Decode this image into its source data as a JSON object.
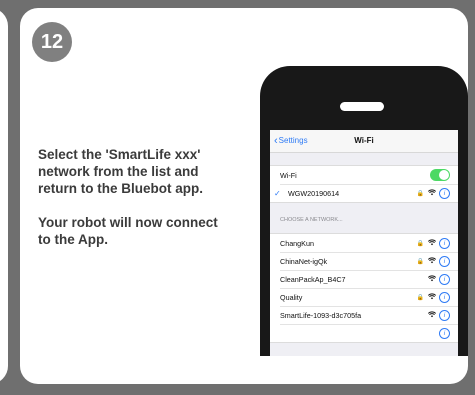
{
  "step_number": "12",
  "instructions": {
    "line1": "Select the 'SmartLife xxx' network from the list and return to the Bluebot app.",
    "line2": "Your robot will now connect to the App."
  },
  "phone": {
    "nav": {
      "back_label": "Settings",
      "title": "Wi-Fi"
    },
    "wifi_toggle": {
      "label": "Wi-Fi",
      "on": true
    },
    "connected_network": "WGW20190614",
    "section_header": "CHOOSE A NETWORK...",
    "networks": [
      {
        "name": "ChangKun",
        "locked": true
      },
      {
        "name": "ChinaNet-igQk",
        "locked": true
      },
      {
        "name": "CleanPackAp_B4C7",
        "locked": false
      },
      {
        "name": "Quality",
        "locked": true
      },
      {
        "name": "SmartLife-1093-d3c705fa",
        "locked": false
      }
    ]
  },
  "colors": {
    "accent": "#2f7bf5",
    "toggle_on": "#4cd964",
    "badge": "#808080",
    "background": "#6f6f6f"
  }
}
